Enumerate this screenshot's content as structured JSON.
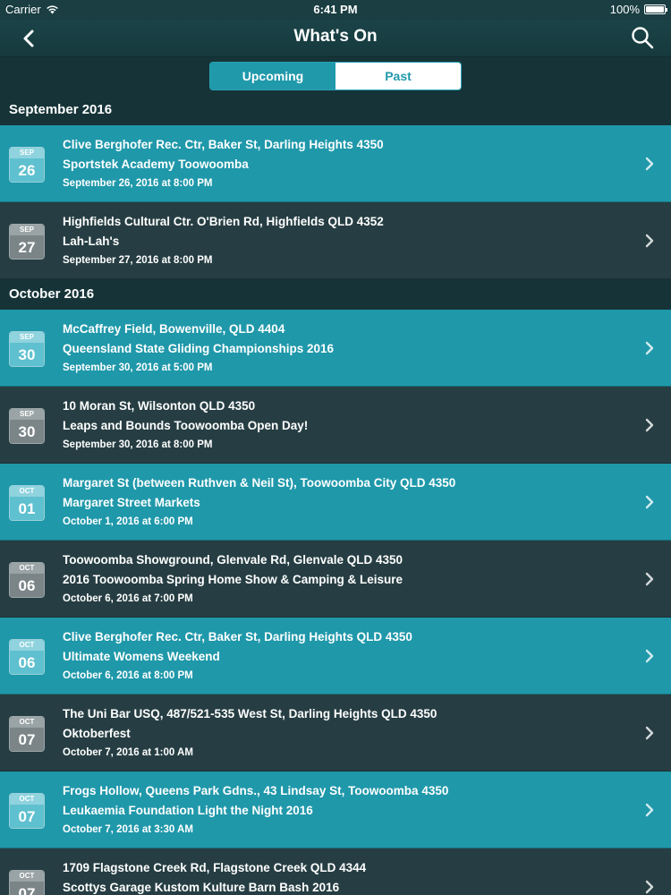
{
  "status_bar": {
    "carrier": "Carrier",
    "time": "6:41 PM",
    "battery": "100%"
  },
  "nav": {
    "title": "What's On",
    "back_icon": "chevron-left-icon",
    "search_icon": "search-icon"
  },
  "segments": [
    {
      "label": "Upcoming",
      "active": true
    },
    {
      "label": "Past",
      "active": false
    }
  ],
  "colors": {
    "accent": "#1f98aa",
    "dark_row": "#263e43",
    "header": "#163438"
  },
  "sections": [
    {
      "title": "September 2016",
      "events": [
        {
          "month": "SEP",
          "day": "26",
          "venue": "Clive Berghofer Rec. Ctr, Baker St, Darling Heights 4350",
          "name": "Sportstek Academy Toowoomba",
          "when": "September 26, 2016 at 8:00 PM",
          "style": "teal"
        },
        {
          "month": "SEP",
          "day": "27",
          "venue": "Highfields Cultural Ctr. O'Brien Rd, Highfields QLD 4352",
          "name": "Lah-Lah's",
          "when": "September 27, 2016 at 8:00 PM",
          "style": "dark"
        }
      ]
    },
    {
      "title": "October 2016",
      "events": [
        {
          "month": "SEP",
          "day": "30",
          "venue": "McCaffrey Field, Bowenville, QLD 4404",
          "name": "Queensland State Gliding Championships 2016",
          "when": "September 30, 2016 at 5:00 PM",
          "style": "teal"
        },
        {
          "month": "SEP",
          "day": "30",
          "venue": "10 Moran St, Wilsonton QLD 4350",
          "name": "Leaps and Bounds Toowoomba Open Day!",
          "when": "September 30, 2016 at 8:00 PM",
          "style": "dark"
        },
        {
          "month": "OCT",
          "day": "01",
          "venue": "Margaret St (between Ruthven & Neil St), Toowoomba City QLD 4350",
          "name": "Margaret Street Markets",
          "when": "October 1, 2016 at 6:00 PM",
          "style": "teal"
        },
        {
          "month": "OCT",
          "day": "06",
          "venue": "Toowoomba Showground, Glenvale Rd, Glenvale QLD 4350",
          "name": "2016 Toowoomba Spring Home Show & Camping & Leisure",
          "when": "October 6, 2016 at 7:00 PM",
          "style": "dark"
        },
        {
          "month": "OCT",
          "day": "06",
          "venue": "Clive Berghofer Rec. Ctr, Baker St, Darling Heights QLD 4350",
          "name": "Ultimate Womens Weekend",
          "when": "October 6, 2016 at 8:00 PM",
          "style": "teal"
        },
        {
          "month": "OCT",
          "day": "07",
          "venue": "The Uni Bar USQ, 487/521-535 West St, Darling Heights QLD 4350",
          "name": "Oktoberfest",
          "when": "October 7, 2016 at 1:00 AM",
          "style": "dark"
        },
        {
          "month": "OCT",
          "day": "07",
          "venue": "Frogs Hollow, Queens Park Gdns., 43 Lindsay St, Toowoomba 4350",
          "name": "Leukaemia Foundation Light the Night 2016",
          "when": "October 7, 2016 at 3:30 AM",
          "style": "teal"
        },
        {
          "month": "OCT",
          "day": "07",
          "venue": "1709 Flagstone Creek Rd, Flagstone Creek QLD 4344",
          "name": "Scottys Garage Kustom Kulture Barn Bash 2016",
          "when": "",
          "style": "dark"
        }
      ]
    }
  ]
}
